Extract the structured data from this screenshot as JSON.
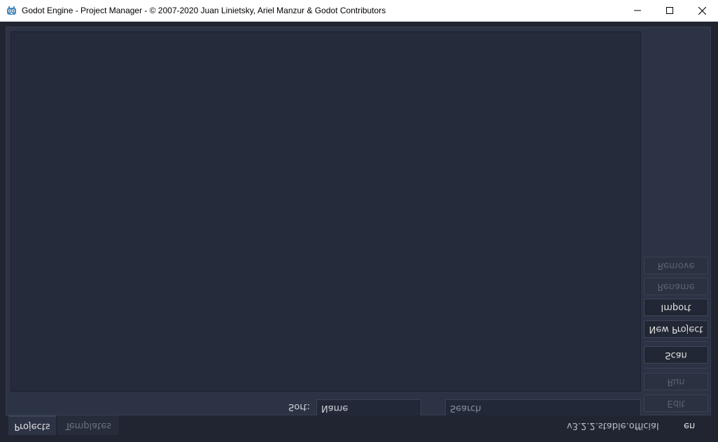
{
  "window": {
    "title": "Godot Engine - Project Manager - © 2007-2020 Juan Linietsky, Ariel Manzur & Godot Contributors",
    "minimize_icon": "minimize-icon",
    "maximize_icon": "maximize-icon",
    "close_icon": "close-icon",
    "app_icon": "godot-logo-icon"
  },
  "colors": {
    "background": "#202531",
    "panel": "#2c3344",
    "list": "#252b3a",
    "accent": "#3a4458"
  },
  "side_buttons": {
    "remove": "Remove",
    "rename": "Rename",
    "import": "Import",
    "new_project": "New Project",
    "scan": "Scan",
    "run": "Run",
    "edit": "Edit"
  },
  "filter": {
    "sort_label": "Sort:",
    "sort_value": "Name",
    "search_placeholder": "Search"
  },
  "tabs": {
    "projects": "Projects",
    "templates": "Templates"
  },
  "footer": {
    "version": "v3.2.2.stable.official",
    "language": "en"
  }
}
